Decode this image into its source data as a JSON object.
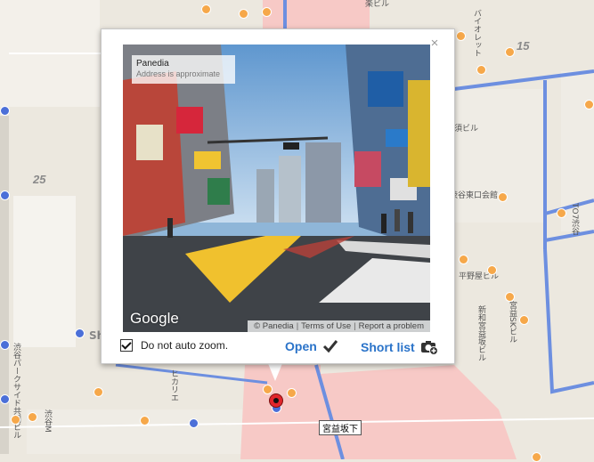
{
  "popup": {
    "close_symbol": "×",
    "info_title": "Panedia",
    "info_subtitle": "Address is approximate",
    "google_logo": "Google",
    "attribution": [
      "© Panedia",
      "Terms of Use",
      "Report a problem"
    ],
    "zoom_label": "Do not auto zoom.",
    "zoom_checked": true,
    "open_label": "Open",
    "short_list_label": "Short list"
  },
  "map": {
    "labels": [
      "楽ビル",
      "バイオレット",
      "15",
      "25",
      "須ビル",
      "渋谷東口会館",
      "平野屋ビル",
      "宮益SKビル",
      "新和宮益坂ビル",
      "TO7渋谷",
      "渋谷パークサイド共同ビル",
      "渋谷M",
      "ヒカリエ",
      "宮益坂下",
      "Sh"
    ],
    "marker_color": "#e1262c",
    "road_color": "#6d8fe0",
    "pink_zone": "#f7c9c6"
  }
}
